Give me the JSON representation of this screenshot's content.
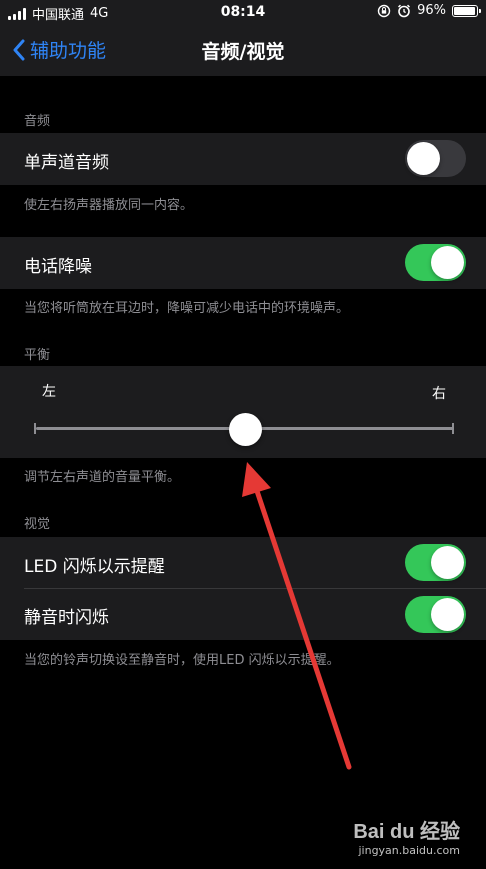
{
  "status_bar": {
    "carrier": "中国联通",
    "network": "4G",
    "time": "08:14",
    "battery": "96%",
    "battery_level": 0.96,
    "icons": [
      "signal-icon",
      "orientation-lock-icon",
      "alarm-icon",
      "battery-icon"
    ]
  },
  "nav": {
    "back_label": "辅助功能",
    "title": "音频/视觉"
  },
  "audio_section": {
    "header": "音频",
    "mono_label": "单声道音频",
    "mono_on": false,
    "mono_footer": "使左右扬声器播放同一内容。",
    "noise_label": "电话降噪",
    "noise_on": true,
    "noise_footer": "当您将听筒放在耳边时，降噪可减少电话中的环境噪声。"
  },
  "balance_section": {
    "header": "平衡",
    "left_label": "左",
    "right_label": "右",
    "value": 0.5,
    "footer": "调节左右声道的音量平衡。"
  },
  "visual_section": {
    "header": "视觉",
    "led_label": "LED 闪烁以示提醒",
    "led_on": true,
    "silent_label": "静音时闪烁",
    "silent_on": true,
    "footer": "当您的铃声切换设至静音时，使用LED 闪烁以示提醒。"
  },
  "watermark": {
    "logo": "Bai du 经验",
    "url": "jingyan.baidu.com"
  },
  "colors": {
    "accent": "#2f84f5",
    "toggle_on": "#34c759",
    "arrow": "#e53935"
  }
}
